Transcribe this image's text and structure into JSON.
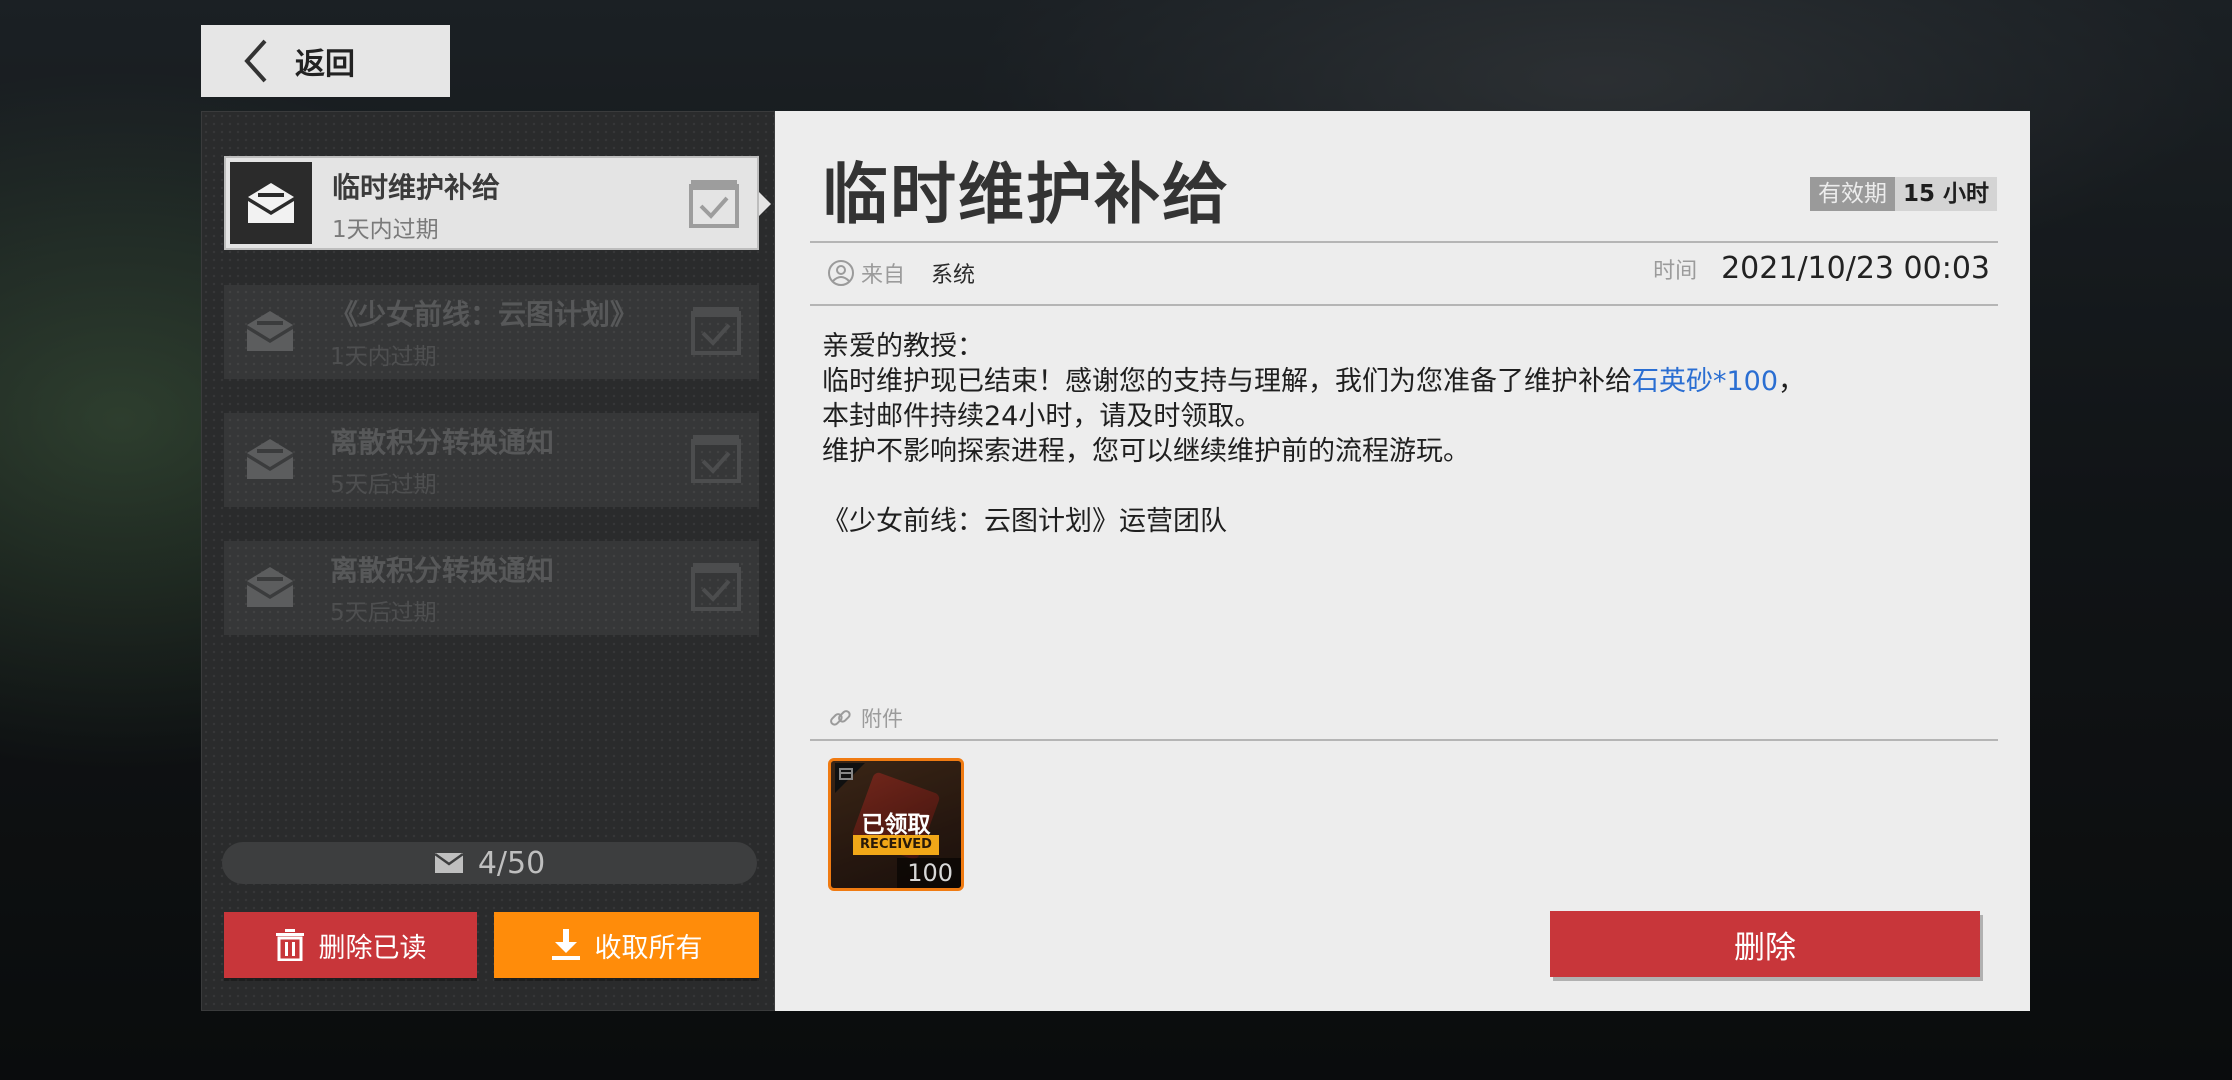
{
  "back_label": "返回",
  "mail_list": [
    {
      "title": "临时维护补给",
      "expiry": "1天内过期",
      "active": true
    },
    {
      "title": "《少女前线：云图计划》",
      "expiry": "1天内过期",
      "active": false
    },
    {
      "title": "离散积分转换通知",
      "expiry": "5天后过期",
      "active": false
    },
    {
      "title": "离散积分转换通知",
      "expiry": "5天后过期",
      "active": false
    }
  ],
  "counter": "4/50",
  "buttons": {
    "delete_read": "删除已读",
    "collect_all": "收取所有",
    "delete": "删除"
  },
  "detail": {
    "title": "临时维护补给",
    "validity_label": "有效期",
    "validity_value": "15 小时",
    "from_label": "来自",
    "from_value": "系统",
    "time_label": "时间",
    "time_value": "2021/10/23 00:03",
    "body": {
      "greeting": "亲爱的教授：",
      "line1_before": "临时维护现已结束！感谢您的支持与理解，我们为您准备了维护补给",
      "line1_highlight": "石英砂*100",
      "line1_after": "，",
      "line2": "本封邮件持续24小时，请及时领取。",
      "line3": "维护不影响探索进程，您可以继续维护前的流程游玩。",
      "signature": "《少女前线：云图计划》运营团队"
    },
    "attachments_label": "附件",
    "attachment": {
      "claimed_label": "已领取",
      "received_label": "RECEIVED",
      "quantity": "100"
    }
  },
  "colors": {
    "accent_red": "#c8363a",
    "accent_orange": "#ff8c0a",
    "highlight_blue": "#2a6ed2"
  }
}
